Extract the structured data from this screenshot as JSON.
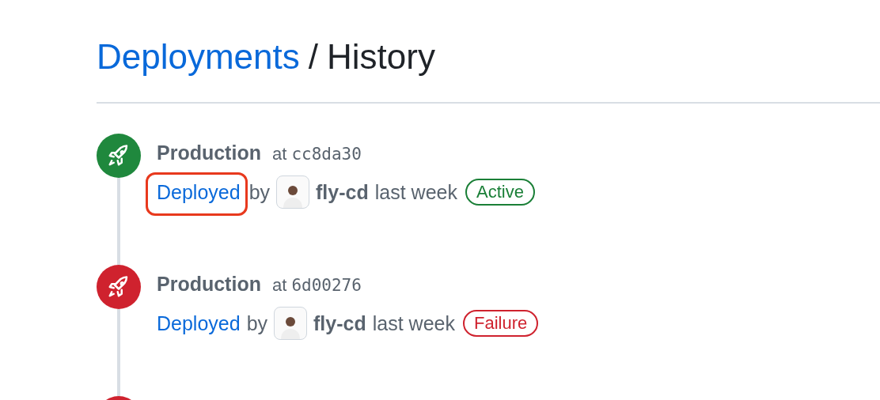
{
  "breadcrumb": {
    "parent": "Deployments",
    "separator": "/",
    "current": "History"
  },
  "deployments": [
    {
      "kind": "active",
      "environment": "Production",
      "commit_prefix": "at",
      "commit": "cc8da30",
      "action": "Deployed",
      "by": "by",
      "user": "fly-cd",
      "time": "last week",
      "badge": "Active",
      "highlighted": true
    },
    {
      "kind": "failure",
      "environment": "Production",
      "commit_prefix": "at",
      "commit": "6d00276",
      "action": "Deployed",
      "by": "by",
      "user": "fly-cd",
      "time": "last week",
      "badge": "Failure",
      "highlighted": false
    },
    {
      "kind": "failure"
    }
  ]
}
